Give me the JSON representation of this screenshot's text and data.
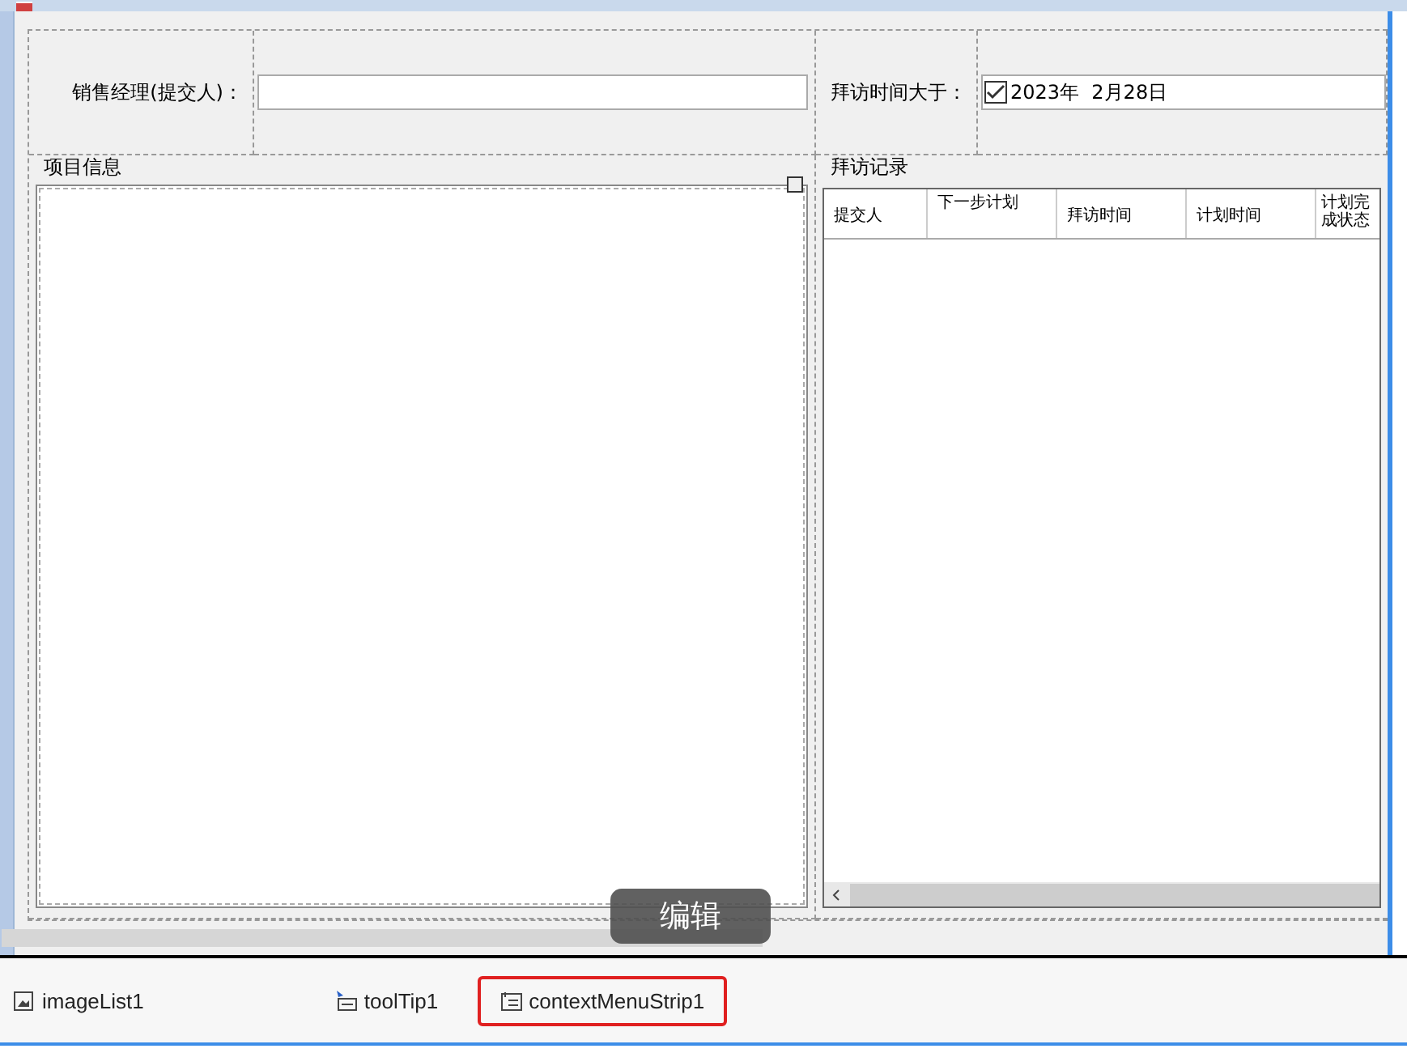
{
  "form": {
    "manager_label": "销售经理(提交人)：",
    "visit_label": "拜访时间大于：",
    "visit_date": {
      "checked": true,
      "value": "2023年  2月28日"
    }
  },
  "project_group": {
    "title": "项目信息"
  },
  "visit_group": {
    "title": "拜访记录",
    "columns": [
      "提交人",
      "下一步计划",
      "拜访时间",
      "计划时间",
      "计划完成状态"
    ]
  },
  "tooltip": "编辑",
  "tray": [
    {
      "label": "imageList1",
      "kind": "imagelist",
      "selected": false
    },
    {
      "label": "toolTip1",
      "kind": "tooltip",
      "selected": false
    },
    {
      "label": "contextMenuStrip1",
      "kind": "menu",
      "selected": true
    }
  ]
}
